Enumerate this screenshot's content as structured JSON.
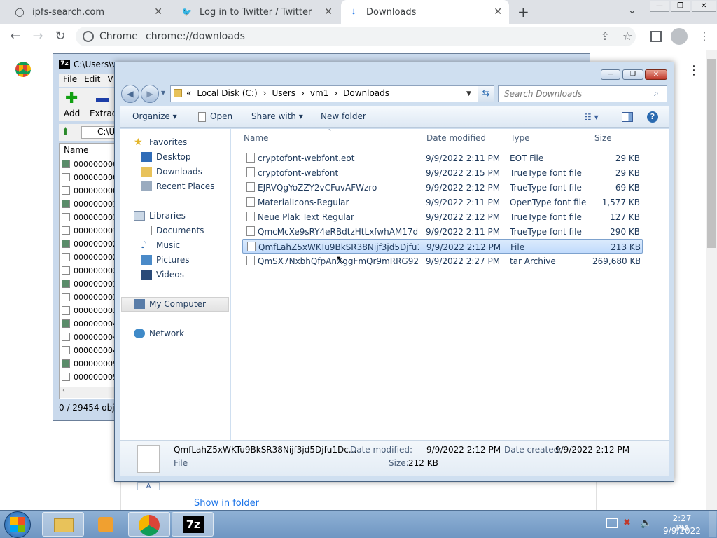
{
  "browser": {
    "tabs": [
      {
        "label": "ipfs-search.com"
      },
      {
        "label": "Log in to Twitter / Twitter"
      },
      {
        "label": "Downloads"
      }
    ],
    "omnibox_site": "Chrome",
    "omnibox_url": "chrome://downloads"
  },
  "sevenzip": {
    "title": "C:\\Users\\vm",
    "menu": [
      "File",
      "Edit",
      "V"
    ],
    "add_label": "Add",
    "extract_label": "Extract",
    "path": "C:\\U",
    "col_name": "Name",
    "rows": [
      "000000000.",
      "000000000.",
      "000000000.",
      "000000001.",
      "000000001.",
      "000000001.",
      "000000002.",
      "000000002.",
      "000000002.",
      "000000003.",
      "000000003.",
      "000000003.",
      "000000004.",
      "000000004.",
      "000000004.",
      "000000005.",
      "000000005."
    ],
    "status": "0 / 29454 objec"
  },
  "explorer": {
    "breadcrumb": [
      "«",
      "Local Disk (C:)",
      "›",
      "Users",
      "›",
      "vm1",
      "›",
      "Downloads"
    ],
    "search_placeholder": "Search Downloads",
    "commands": {
      "organize": "Organize ▾",
      "open": "Open",
      "share": "Share with ▾",
      "newfolder": "New folder"
    },
    "nav": {
      "favorites": "Favorites",
      "desktop": "Desktop",
      "downloads": "Downloads",
      "recent": "Recent Places",
      "libraries": "Libraries",
      "documents": "Documents",
      "music": "Music",
      "pictures": "Pictures",
      "videos": "Videos",
      "computer": "My Computer",
      "network": "Network"
    },
    "columns": {
      "name": "Name",
      "date": "Date modified",
      "type": "Type",
      "size": "Size"
    },
    "files": [
      {
        "name": "cryptofont-webfont.eot",
        "date": "9/9/2022 2:11 PM",
        "type": "EOT File",
        "size": "29 KB"
      },
      {
        "name": "cryptofont-webfont",
        "date": "9/9/2022 2:15 PM",
        "type": "TrueType font file",
        "size": "29 KB"
      },
      {
        "name": "EJRVQgYoZZY2vCFuvAFWzro",
        "date": "9/9/2022 2:12 PM",
        "type": "TrueType font file",
        "size": "69 KB"
      },
      {
        "name": "MaterialIcons-Regular",
        "date": "9/9/2022 2:11 PM",
        "type": "OpenType font file",
        "size": "1,577 KB"
      },
      {
        "name": "Neue Plak Text Regular",
        "date": "9/9/2022 2:12 PM",
        "type": "TrueType font file",
        "size": "127 KB"
      },
      {
        "name": "QmcMcXe9sRY4eRBdtzHtLxfwhAM17dht...",
        "date": "9/9/2022 2:11 PM",
        "type": "TrueType font file",
        "size": "290 KB"
      },
      {
        "name": "QmfLahZ5xWKTu9BkSR38Nijf3jd5Djfu1D...",
        "date": "9/9/2022 2:12 PM",
        "type": "File",
        "size": "213 KB"
      },
      {
        "name": "QmSX7NxbhQfpAnXggFmQr9mRRG92...",
        "date": "9/9/2022 2:27 PM",
        "type": "tar Archive",
        "size": "269,680 KB"
      }
    ],
    "details": {
      "name": "QmfLahZ5xWKTu9BkSR38Nijf3jd5Djfu1Dc...",
      "kind": "File",
      "modified_label": "Date modified:",
      "modified": "9/9/2022 2:12 PM",
      "size_label": "Size:",
      "size": "212 KB",
      "created_label": "Date created:",
      "created": "9/9/2022 2:12 PM"
    }
  },
  "downloads_page": {
    "show_in_folder": "Show in folder"
  },
  "taskbar": {
    "time": "2:27 PM",
    "date": "9/9/2022"
  }
}
